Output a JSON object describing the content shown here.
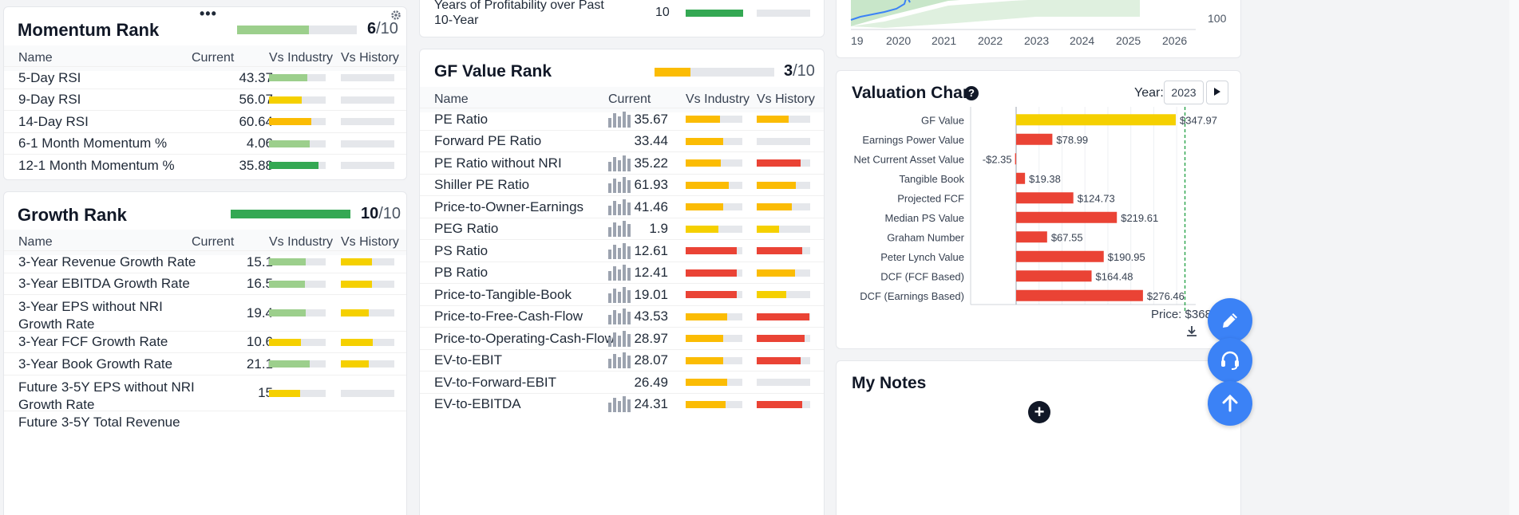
{
  "colors": {
    "green_dark": "#34a853",
    "green_light": "#9ccf8c",
    "yellow": "#f5d000",
    "orange": "#fbbc04",
    "red": "#ea4335",
    "blue": "#3b82f6",
    "track": "#e5e7eb"
  },
  "momentum": {
    "title": "Momentum Rank",
    "score": "6",
    "max": "/10",
    "fill": 0.6,
    "columns": [
      "Name",
      "Current",
      "Vs Industry",
      "Vs History"
    ],
    "rows": [
      {
        "name": "5-Day RSI",
        "value": "43.37",
        "ind": 0.68,
        "ind_color": "green_light",
        "hist": 0
      },
      {
        "name": "9-Day RSI",
        "value": "56.07",
        "ind": 0.58,
        "ind_color": "yellow",
        "hist": 0
      },
      {
        "name": "14-Day RSI",
        "value": "60.64",
        "ind": 0.75,
        "ind_color": "orange",
        "hist": 0
      },
      {
        "name": "6-1 Month Momentum %",
        "value": "4.06",
        "ind": 0.72,
        "ind_color": "green_light",
        "hist": 0
      },
      {
        "name": "12-1 Month Momentum %",
        "value": "35.88",
        "ind": 0.88,
        "ind_color": "green_dark",
        "hist": 0
      }
    ]
  },
  "growth": {
    "title": "Growth Rank",
    "score": "10",
    "max": "/10",
    "fill": 1.0,
    "columns": [
      "Name",
      "Current",
      "Vs Industry",
      "Vs History"
    ],
    "rows": [
      {
        "name": "3-Year Revenue Growth Rate",
        "value": "15.1",
        "ind": 0.65,
        "ind_color": "green_light",
        "hist": 0.58,
        "hist_color": "yellow"
      },
      {
        "name": "3-Year EBITDA Growth Rate",
        "value": "16.5",
        "ind": 0.63,
        "ind_color": "green_light",
        "hist": 0.58,
        "hist_color": "yellow"
      },
      {
        "name": "3-Year EPS without NRI",
        "name2": "Growth Rate",
        "value": "19.4",
        "ind": 0.65,
        "ind_color": "green_light",
        "hist": 0.52,
        "hist_color": "yellow"
      },
      {
        "name": "3-Year FCF Growth Rate",
        "value": "10.6",
        "ind": 0.57,
        "ind_color": "yellow",
        "hist": 0.6,
        "hist_color": "yellow"
      },
      {
        "name": "3-Year Book Growth Rate",
        "value": "21.1",
        "ind": 0.72,
        "ind_color": "green_light",
        "hist": 0.52,
        "hist_color": "yellow"
      },
      {
        "name": "Future 3-5Y EPS without NRI",
        "name2": "Growth Rate",
        "value": "15",
        "ind": 0.55,
        "ind_color": "yellow",
        "hist": 0
      },
      {
        "name": "Future 3-5Y Total Revenue",
        "value": "",
        "ind": 0,
        "hist": 0
      }
    ]
  },
  "profitability": {
    "label_line1": "Years of Profitability over Past",
    "label_line2": "10-Year",
    "value": "10",
    "ind": 1.0,
    "ind_color": "green_dark"
  },
  "gfvalue": {
    "title": "GF Value Rank",
    "score": "3",
    "max": "/10",
    "fill": 0.3,
    "columns": [
      "Name",
      "Current",
      "Vs Industry",
      "Vs History"
    ],
    "rows": [
      {
        "name": "PE Ratio",
        "value": "35.67",
        "icon": true,
        "ind": 0.6,
        "ind_color": "orange",
        "hist": 0.6,
        "hist_color": "orange"
      },
      {
        "name": "Forward PE Ratio",
        "value": "33.44",
        "icon": false,
        "ind": 0.66,
        "ind_color": "orange",
        "hist": 0
      },
      {
        "name": "PE Ratio without NRI",
        "value": "35.22",
        "icon": true,
        "ind": 0.62,
        "ind_color": "orange",
        "hist": 0.82,
        "hist_color": "red"
      },
      {
        "name": "Shiller PE Ratio",
        "value": "61.93",
        "icon": true,
        "ind": 0.76,
        "ind_color": "orange",
        "hist": 0.73,
        "hist_color": "orange"
      },
      {
        "name": "Price-to-Owner-Earnings",
        "value": "41.46",
        "icon": true,
        "ind": 0.66,
        "ind_color": "orange",
        "hist": 0.66,
        "hist_color": "orange"
      },
      {
        "name": "PEG Ratio",
        "value": "1.9",
        "icon": true,
        "ind": 0.58,
        "ind_color": "yellow",
        "hist": 0.42,
        "hist_color": "yellow"
      },
      {
        "name": "PS Ratio",
        "value": "12.61",
        "icon": true,
        "ind": 0.9,
        "ind_color": "red",
        "hist": 0.85,
        "hist_color": "red"
      },
      {
        "name": "PB Ratio",
        "value": "12.41",
        "icon": true,
        "ind": 0.9,
        "ind_color": "red",
        "hist": 0.72,
        "hist_color": "orange"
      },
      {
        "name": "Price-to-Tangible-Book",
        "value": "19.01",
        "icon": true,
        "ind": 0.9,
        "ind_color": "red",
        "hist": 0.55,
        "hist_color": "yellow"
      },
      {
        "name": "Price-to-Free-Cash-Flow",
        "value": "43.53",
        "icon": true,
        "ind": 0.73,
        "ind_color": "orange",
        "hist": 0.98,
        "hist_color": "red"
      },
      {
        "name": "Price-to-Operating-Cash-Flow",
        "value": "28.97",
        "icon": true,
        "ind": 0.66,
        "ind_color": "orange",
        "hist": 0.9,
        "hist_color": "red"
      },
      {
        "name": "EV-to-EBIT",
        "value": "28.07",
        "icon": true,
        "ind": 0.66,
        "ind_color": "orange",
        "hist": 0.82,
        "hist_color": "red"
      },
      {
        "name": "EV-to-Forward-EBIT",
        "value": "26.49",
        "icon": false,
        "ind": 0.73,
        "ind_color": "orange",
        "hist": 0
      },
      {
        "name": "EV-to-EBITDA",
        "value": "24.31",
        "icon": true,
        "ind": 0.7,
        "ind_color": "orange",
        "hist": 0.85,
        "hist_color": "red"
      }
    ]
  },
  "price_chart": {
    "x_ticks": [
      "19",
      "2020",
      "2021",
      "2022",
      "2023",
      "2024",
      "2025",
      "2026"
    ],
    "y_tick": "100"
  },
  "valuation": {
    "title": "Valuation Chart",
    "help": "?",
    "year_label": "Year:",
    "year_value": "2023",
    "price_label": "Price: $368",
    "price_value": 368
  },
  "chart_data": {
    "type": "bar",
    "title": "Valuation Chart",
    "categories": [
      "GF Value",
      "Earnings Power Value",
      "Net Current Asset Value",
      "Tangible Book",
      "Projected FCF",
      "Median PS Value",
      "Graham Number",
      "Peter Lynch Value",
      "DCF (FCF Based)",
      "DCF (Earnings Based)"
    ],
    "values": [
      347.97,
      78.99,
      -2.35,
      19.38,
      124.73,
      219.61,
      67.55,
      190.95,
      164.48,
      276.46
    ],
    "labels": [
      "$347.97",
      "$78.99",
      "-$2.35",
      "$19.38",
      "$124.73",
      "$219.61",
      "$67.55",
      "$190.95",
      "$164.48",
      "$276.46"
    ],
    "colors": [
      "#f5d000",
      "#ea4335",
      "#ea4335",
      "#ea4335",
      "#ea4335",
      "#ea4335",
      "#ea4335",
      "#ea4335",
      "#ea4335",
      "#ea4335"
    ],
    "reference_line": 368
  },
  "notes": {
    "title": "My Notes",
    "add": "+"
  }
}
